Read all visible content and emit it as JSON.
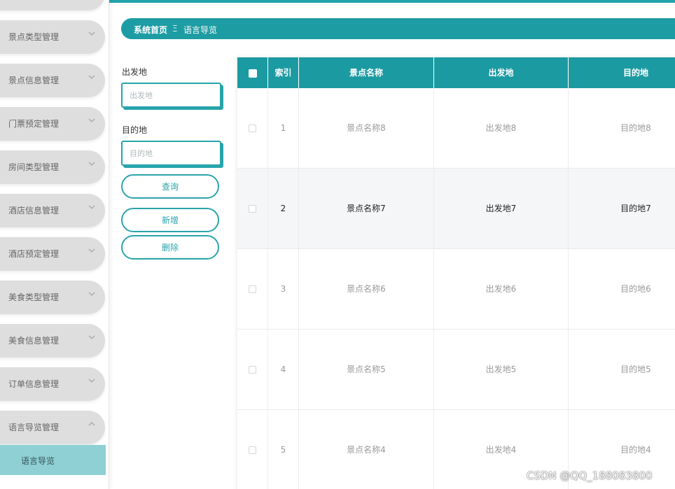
{
  "sidebar": {
    "menu": [
      {
        "label": ""
      },
      {
        "label": "景点类型管理"
      },
      {
        "label": "景点信息管理"
      },
      {
        "label": "门票预定管理"
      },
      {
        "label": "房间类型管理"
      },
      {
        "label": "酒店信息管理"
      },
      {
        "label": "酒店预定管理"
      },
      {
        "label": "美食类型管理"
      },
      {
        "label": "美食信息管理"
      },
      {
        "label": "订单信息管理"
      },
      {
        "label": "语言导览管理"
      }
    ],
    "submenu_active": "语言导览"
  },
  "breadcrumb": {
    "home": "系统首页",
    "separator": "Ξ",
    "current": "语言导览"
  },
  "search": {
    "departure_label": "出发地",
    "departure_placeholder": "出发地",
    "departure_value": "",
    "destination_label": "目的地",
    "destination_placeholder": "目的地",
    "destination_value": "",
    "query_button": "查询",
    "add_button": "新增",
    "delete_button": "删除"
  },
  "table": {
    "columns": [
      "索引",
      "景点名称",
      "出发地",
      "目的地"
    ],
    "rows": [
      {
        "index": "1",
        "name": "景点名称8",
        "from": "出发地8",
        "to": "目的地8"
      },
      {
        "index": "2",
        "name": "景点名称7",
        "from": "出发地7",
        "to": "目的地7"
      },
      {
        "index": "3",
        "name": "景点名称6",
        "from": "出发地6",
        "to": "目的地6"
      },
      {
        "index": "4",
        "name": "景点名称5",
        "from": "出发地5",
        "to": "目的地5"
      },
      {
        "index": "5",
        "name": "景点名称4",
        "from": "出发地4",
        "to": "目的地4"
      }
    ]
  },
  "watermark": "CSDN @QQ_188083800",
  "colors": {
    "accent": "#1e9ca3",
    "menu_bg": "#dedede",
    "submenu_active_bg": "#8ed0d4"
  }
}
